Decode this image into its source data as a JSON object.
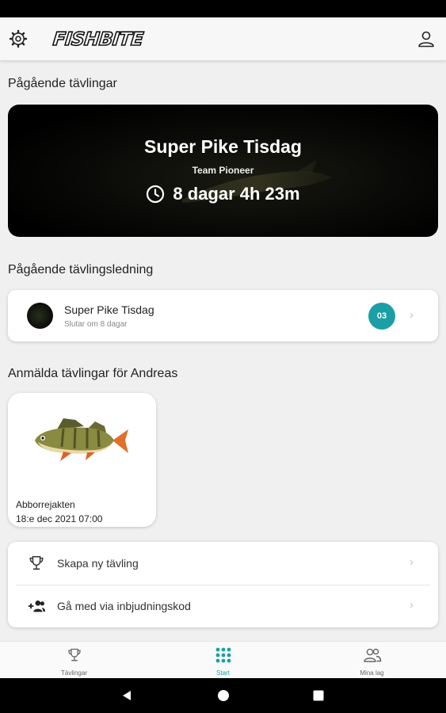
{
  "header": {
    "logo_text": "FISHBITE",
    "settings_icon": "gear-icon",
    "profile_icon": "user-icon"
  },
  "ongoing": {
    "section_title": "Pågående tävlingar",
    "competition_title": "Super Pike Tisdag",
    "team": "Team Pioneer",
    "time_remaining": "8 dagar 4h 23m"
  },
  "leaderboard": {
    "section_title": "Pågående tävlingsledning",
    "name": "Super Pike Tisdag",
    "subtitle": "Slutar om 8 dagar",
    "rank": "03"
  },
  "registered": {
    "section_title": "Anmälda tävlingar för Andreas",
    "items": [
      {
        "name": "Abborrejakten",
        "date": "18:e dec 2021 07:00"
      }
    ]
  },
  "actions": [
    {
      "label": "Skapa ny tävling",
      "icon": "trophy-icon"
    },
    {
      "label": "Gå med via inbjudningskod",
      "icon": "add-user-icon"
    }
  ],
  "bottom_nav": [
    {
      "label": "Tävlingar",
      "icon": "trophy-icon",
      "active": false
    },
    {
      "label": "Start",
      "icon": "grid-icon",
      "active": true
    },
    {
      "label": "Mina lag",
      "icon": "group-icon",
      "active": false
    }
  ],
  "colors": {
    "accent": "#1a9fa4",
    "background": "#f0f0f0",
    "hero_background": "#000000"
  }
}
